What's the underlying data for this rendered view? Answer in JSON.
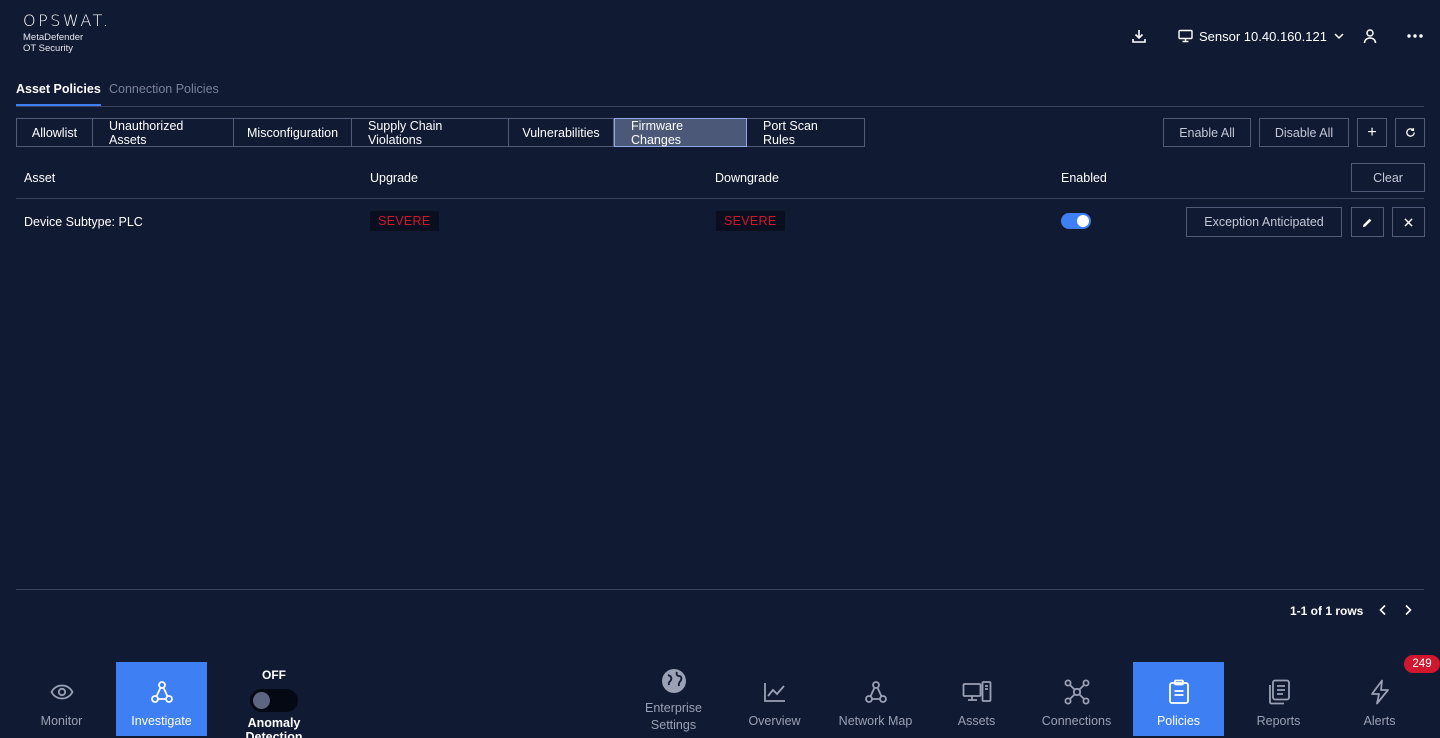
{
  "brand": {
    "name": "OPSWAT.",
    "product_line1": "MetaDefender",
    "product_line2": "OT Security"
  },
  "header": {
    "sensor_label": "Sensor 10.40.160.121",
    "icons": [
      "download-icon",
      "monitor-icon",
      "chevron-down-icon",
      "user-icon",
      "more-icon"
    ]
  },
  "policy_tabs": {
    "asset": "Asset Policies",
    "connection": "Connection Policies"
  },
  "subtabs": [
    {
      "label": "Allowlist",
      "active": false
    },
    {
      "label": "Unauthorized Assets",
      "active": false
    },
    {
      "label": "Misconfiguration",
      "active": false
    },
    {
      "label": "Supply Chain Violations",
      "active": false
    },
    {
      "label": "Vulnerabilities",
      "active": false
    },
    {
      "label": "Firmware Changes",
      "active": true
    },
    {
      "label": "Port Scan Rules",
      "active": false
    }
  ],
  "actions": {
    "enable_all": "Enable All",
    "disable_all": "Disable All",
    "add": "+",
    "clear": "Clear"
  },
  "table": {
    "columns": [
      "Asset",
      "Upgrade",
      "Downgrade",
      "Enabled"
    ],
    "rows": [
      {
        "asset": "Device Subtype: PLC",
        "upgrade": "SEVERE",
        "downgrade": "SEVERE",
        "enabled": true,
        "exception": "Exception Anticipated"
      }
    ]
  },
  "pagination": {
    "text": "1-1 of 1 rows"
  },
  "anomaly": {
    "state": "OFF",
    "label": "Anomaly Detection"
  },
  "nav": {
    "monitor": "Monitor",
    "investigate": "Investigate",
    "enterprise_line1": "Enterprise",
    "enterprise_line2": "Settings",
    "overview": "Overview",
    "network_map": "Network Map",
    "assets": "Assets",
    "connections": "Connections",
    "policies": "Policies",
    "reports": "Reports",
    "alerts": "Alerts",
    "alerts_count": "249"
  },
  "colors": {
    "background": "#111a33",
    "accent": "#3f7ff4",
    "severe": "#d0172e",
    "border": "#525b77"
  }
}
